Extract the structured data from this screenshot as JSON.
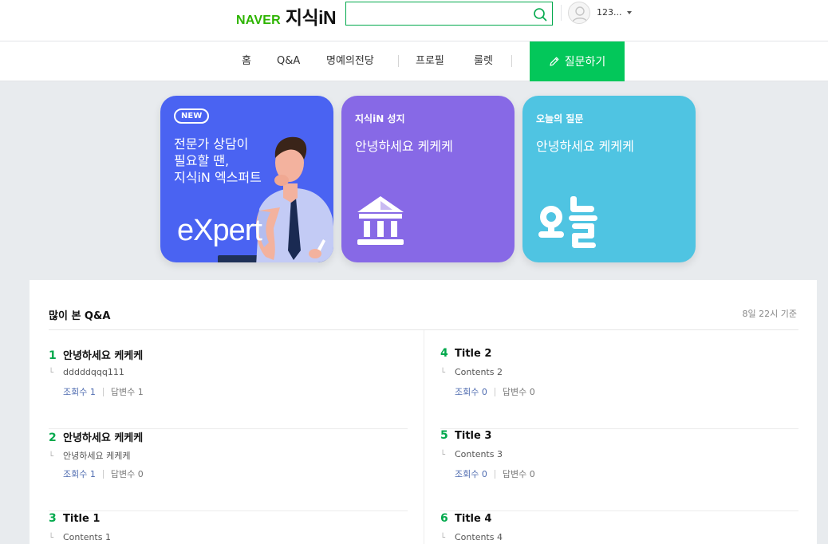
{
  "header": {
    "logo_naver": "NAVER",
    "logo_kin": "지식iN",
    "search_value": "",
    "user_name": "123..."
  },
  "nav": {
    "items": [
      "홈",
      "Q&A",
      "명예의전당",
      "프로필",
      "룰렛"
    ],
    "ask_button": "질문하기"
  },
  "cards": {
    "expert": {
      "badge": "NEW",
      "text_lines": [
        "전문가 상담이",
        "필요할 땐,",
        "지식iN 엑스퍼트"
      ],
      "logo": "eXpert"
    },
    "holy": {
      "label": "지식iN 성지",
      "subtitle": "안녕하세요 케케케",
      "icon": "landmark-icon"
    },
    "today": {
      "label": "오늘의 질문",
      "subtitle": "안녕하세요 케케케",
      "icon": "today-lettering-icon"
    }
  },
  "popular": {
    "title": "많이 본 Q&A",
    "date": "8일 22시 기준",
    "items": [
      {
        "rank": "1",
        "title": "안녕하세요 케케케",
        "content": "dddddqqq111",
        "views": "조회수 1",
        "answers": "답변수 1"
      },
      {
        "rank": "2",
        "title": "안녕하세요 케케케",
        "content": "안녕하세요 케케케",
        "views": "조회수 1",
        "answers": "답변수 0"
      },
      {
        "rank": "3",
        "title": "Title 1",
        "content": "Contents 1",
        "views": "",
        "answers": ""
      },
      {
        "rank": "4",
        "title": "Title 2",
        "content": "Contents 2",
        "views": "조회수 0",
        "answers": "답변수 0"
      },
      {
        "rank": "5",
        "title": "Title 3",
        "content": "Contents 3",
        "views": "조회수 0",
        "answers": "답변수 0"
      },
      {
        "rank": "6",
        "title": "Title 4",
        "content": "Contents 4",
        "views": "",
        "answers": ""
      }
    ]
  },
  "colors": {
    "brand_green": "#03c75a",
    "rank_green": "#03a94d",
    "expert_card": "#4a63f2",
    "holy_card": "#8769e6",
    "today_card": "#4fc4e2"
  }
}
